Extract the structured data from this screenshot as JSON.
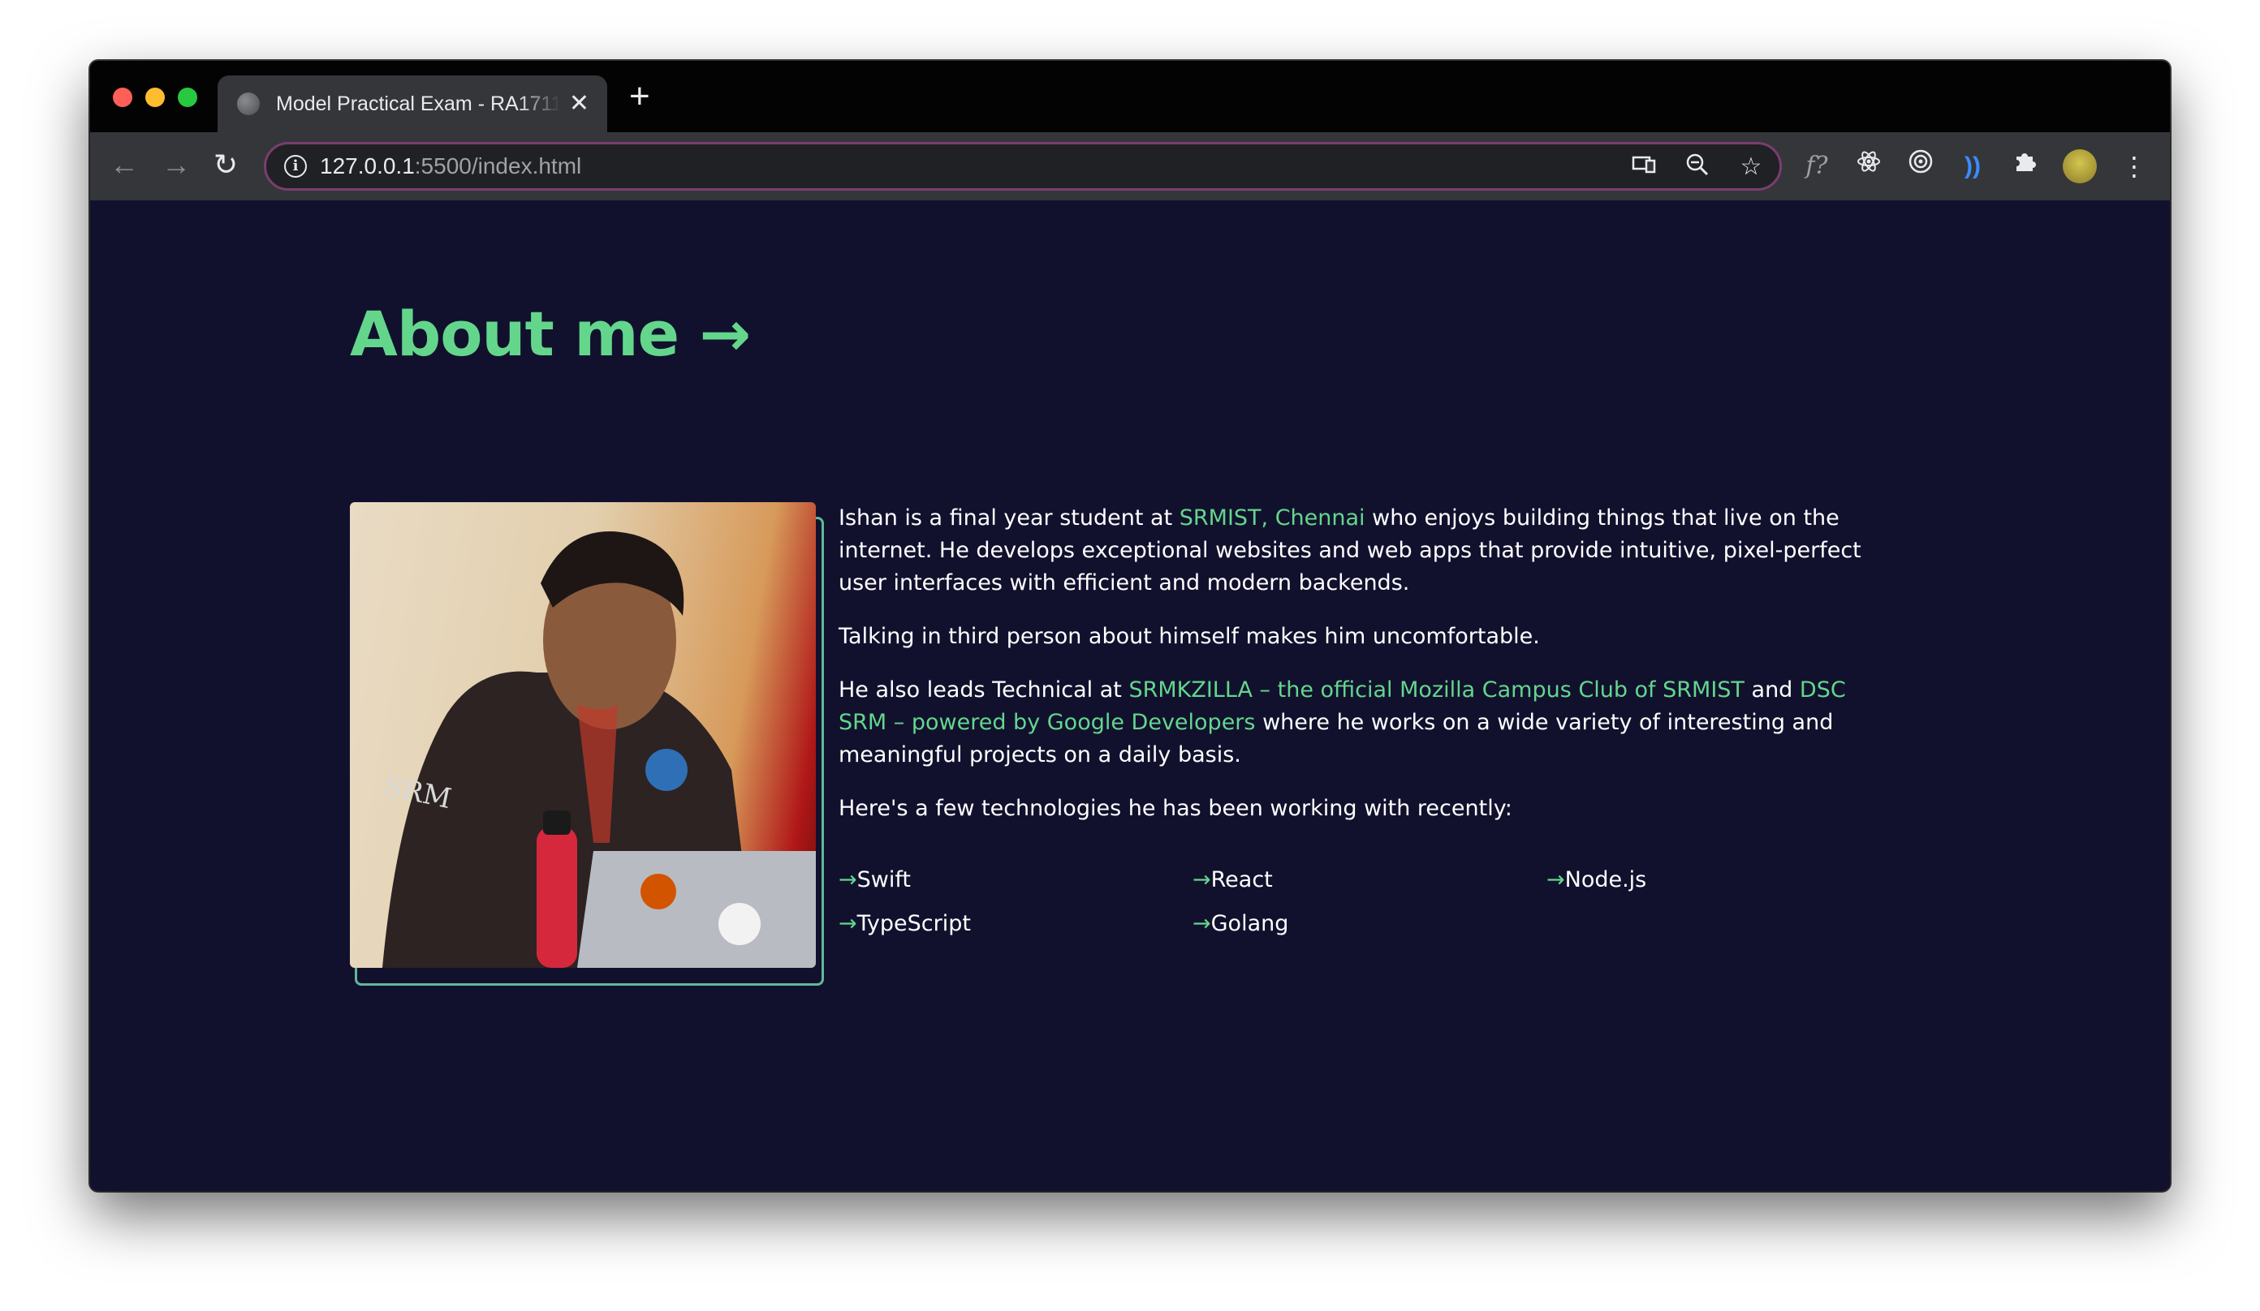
{
  "browser": {
    "tab_title": "Model Practical Exam - RA1711",
    "tab_close_icon": "close-icon",
    "new_tab_label": "+",
    "url_host": "127.0.0.1",
    "url_path": ":5500/index.html",
    "accent_border": "#7a3d6e"
  },
  "page": {
    "heading": "About me →",
    "heading_color": "#64d68c",
    "background": "#11112e",
    "bio": {
      "p1_a": "Ishan is a final year student at ",
      "p1_link": "SRMIST, Chennai",
      "p1_b": " who enjoys building things that live on the internet. He develops exceptional websites and web apps that provide intuitive, pixel-perfect user interfaces with efficient and modern backends.",
      "p2": "Talking in third person about himself makes him uncomfortable.",
      "p3_a": "He also leads Technical at ",
      "p3_link1": "SRMKZILLA – the official Mozilla Campus Club of SRMIST",
      "p3_and": " and ",
      "p3_link2": "DSC SRM – powered by Google Developers",
      "p3_b": " where he works on a wide variety of interesting and meaningful projects on a daily basis.",
      "p4": "Here's a few technologies he has been working with recently:"
    },
    "technologies": [
      {
        "arrow": "→",
        "name": "Swift"
      },
      {
        "arrow": "→",
        "name": "React"
      },
      {
        "arrow": "→",
        "name": "Node.js"
      },
      {
        "arrow": "→",
        "name": "TypeScript"
      },
      {
        "arrow": "→",
        "name": "Golang"
      }
    ]
  }
}
